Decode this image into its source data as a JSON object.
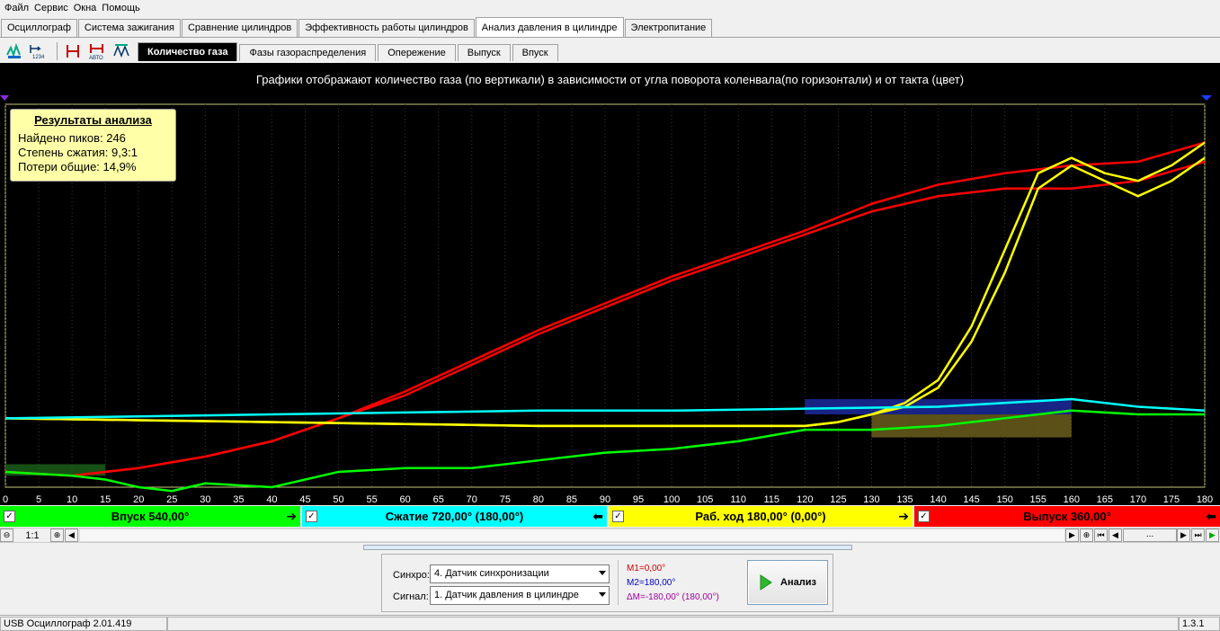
{
  "menu": [
    "Файл",
    "Сервис",
    "Окна",
    "Помощь"
  ],
  "main_tabs": [
    {
      "label": "Осциллограф",
      "active": false
    },
    {
      "label": "Система зажигания",
      "active": false
    },
    {
      "label": "Сравнение цилиндров",
      "active": false
    },
    {
      "label": "Эффективность работы цилиндров",
      "active": false
    },
    {
      "label": "Анализ давления в цилиндре",
      "active": true
    },
    {
      "label": "Электропитание",
      "active": false
    }
  ],
  "toolbar_icons": [
    "waveform-icon",
    "step-1234-icon",
    "marker-icon",
    "auto-marker-icon",
    "signal-grid-icon"
  ],
  "sub_tabs": [
    {
      "label": "Количество газа",
      "active": true
    },
    {
      "label": "Фазы газораспределения",
      "active": false
    },
    {
      "label": "Опережение",
      "active": false
    },
    {
      "label": "Выпуск",
      "active": false
    },
    {
      "label": "Впуск",
      "active": false
    }
  ],
  "chart_title": "Графики отображают количество газа (по вертикали) в зависимости от угла поворота коленвала(по горизонтали) и от такта (цвет)",
  "results": {
    "header": "Результаты анализа",
    "peaks": "Найдено пиков: 246",
    "compression": "Степень сжатия: 9,3:1",
    "losses": "Потери общие: 14,9%"
  },
  "phases": [
    {
      "label": "Впуск 540,00°",
      "color": "#00ff00",
      "arrow": "➔"
    },
    {
      "label": "Сжатие 720,00° (180,00°)",
      "color": "#00ffff",
      "arrow": "⬅"
    },
    {
      "label": "Раб. ход 180,00° (0,00°)",
      "color": "#ffff00",
      "arrow": "➔"
    },
    {
      "label": "Выпуск 360,00°",
      "color": "#ff0000",
      "arrow": "⬅"
    }
  ],
  "scroll": {
    "zoom": "1:1",
    "page": "..."
  },
  "controls": {
    "sync_label": "Синхро:",
    "sync_value": "4.  Датчик синхронизации",
    "signal_label": "Сигнал:",
    "signal_value": "1.  Датчик давления в цилиндре",
    "m1": "M1=0,00°",
    "m2": "M2=180,00°",
    "dm": "ΔM=-180,00° (180,00°)",
    "analyze_label": "Анализ"
  },
  "status": {
    "app": "USB Осциллограф  2.01.419",
    "version": "1.3.1"
  },
  "chart_data": {
    "type": "line",
    "title": "Графики отображают количество газа (по вертикали) в зависимости от угла поворота коленвала(по горизонтали) и от такта (цвет)",
    "xlabel": "",
    "ylabel": "",
    "xlim": [
      0,
      180
    ],
    "ylim": [
      0,
      100
    ],
    "x_ticks": [
      0,
      5,
      10,
      15,
      20,
      25,
      30,
      35,
      40,
      45,
      50,
      55,
      60,
      65,
      70,
      75,
      80,
      85,
      90,
      95,
      100,
      105,
      110,
      115,
      120,
      125,
      130,
      135,
      140,
      145,
      150,
      155,
      160,
      165,
      170,
      175,
      180
    ],
    "grid": true,
    "series": [
      {
        "color": "#ff0000",
        "x": [
          0,
          10,
          20,
          30,
          40,
          50,
          60,
          70,
          80,
          90,
          100,
          110,
          120,
          130,
          140,
          150,
          160,
          170,
          180
        ],
        "y": [
          4,
          3,
          5,
          8,
          12,
          18,
          25,
          33,
          41,
          48,
          55,
          61,
          67,
          74,
          79,
          82,
          84,
          85,
          90
        ]
      },
      {
        "color": "#ff0000",
        "x": [
          0,
          10,
          20,
          30,
          40,
          50,
          60,
          70,
          80,
          90,
          100,
          110,
          120,
          130,
          140,
          150,
          160,
          170,
          180
        ],
        "y": [
          4,
          3,
          5,
          8,
          12,
          18,
          24,
          32,
          40,
          47,
          54,
          60,
          66,
          72,
          76,
          78,
          78,
          80,
          85
        ]
      },
      {
        "color": "#ffff00",
        "x": [
          0,
          20,
          40,
          60,
          80,
          100,
          120,
          125,
          130,
          135,
          140,
          145,
          150,
          155,
          160,
          165,
          170,
          175,
          180
        ],
        "y": [
          18,
          17.5,
          17,
          16.5,
          16,
          16,
          16,
          17,
          19,
          22,
          28,
          42,
          62,
          82,
          86,
          82,
          80,
          84,
          90
        ]
      },
      {
        "color": "#ffff00",
        "x": [
          0,
          20,
          40,
          60,
          80,
          100,
          120,
          125,
          130,
          135,
          140,
          145,
          150,
          155,
          160,
          165,
          170,
          175,
          180
        ],
        "y": [
          18,
          17.5,
          17,
          16.5,
          16,
          16,
          16,
          17,
          19,
          21,
          26,
          38,
          56,
          78,
          84,
          80,
          76,
          80,
          86
        ]
      },
      {
        "color": "#00ffff",
        "x": [
          0,
          20,
          40,
          60,
          80,
          100,
          120,
          140,
          150,
          160,
          170,
          180
        ],
        "y": [
          18,
          18.5,
          19,
          19.5,
          20,
          20,
          20.5,
          21,
          22,
          23,
          21,
          20
        ]
      },
      {
        "color": "#00ff00",
        "x": [
          0,
          10,
          15,
          20,
          25,
          30,
          40,
          50,
          60,
          70,
          80,
          90,
          100,
          110,
          120,
          130,
          140,
          150,
          160,
          170,
          180
        ],
        "y": [
          4,
          3,
          2,
          0,
          -1,
          1,
          0,
          4,
          5,
          5,
          7,
          9,
          10,
          12,
          15,
          15,
          16,
          18,
          20,
          19,
          19
        ]
      }
    ],
    "shaded_regions": [
      {
        "color": "#1a5e1a",
        "x": [
          0,
          15
        ],
        "y": [
          3,
          6
        ]
      },
      {
        "color": "#1b2a9e",
        "x": [
          120,
          160
        ],
        "y": [
          19,
          23
        ]
      },
      {
        "color": "#6b5e1c",
        "x": [
          130,
          160
        ],
        "y": [
          13,
          19
        ]
      }
    ]
  }
}
